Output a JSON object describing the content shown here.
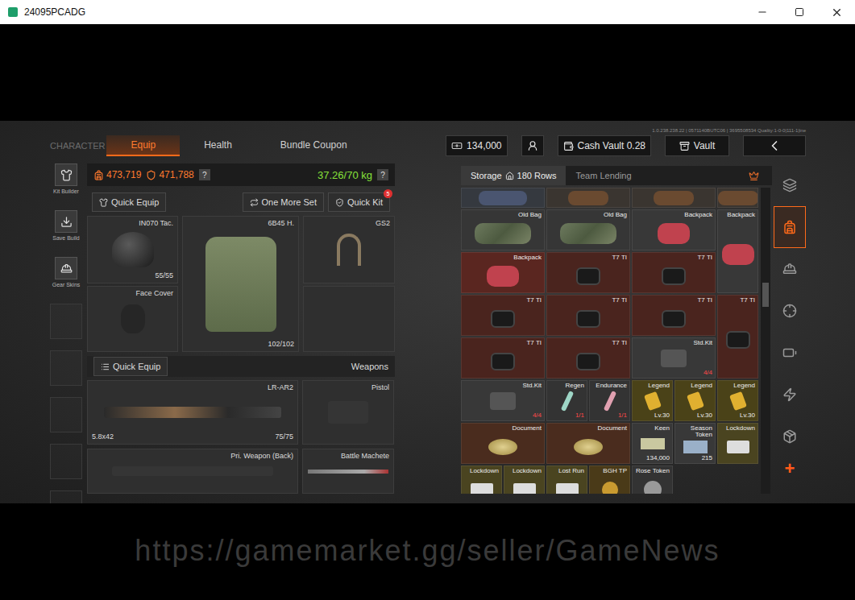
{
  "window": {
    "title": "24095PCADG"
  },
  "version": "1.0.238.238.22 | 0571140BUTC06 | 3695508534  Quality:1-0-0|111-1|ine",
  "nav": {
    "section": "CHARACTER",
    "tabs": [
      {
        "label": "Equip",
        "selected": true
      },
      {
        "label": "Health",
        "selected": false
      },
      {
        "label": "Bundle Coupon",
        "selected": false
      }
    ]
  },
  "wallet": {
    "cash": "134,000",
    "cash_vault": "Cash Vault 0.28",
    "vault": "Vault"
  },
  "tools": [
    {
      "label": "Kit Builder"
    },
    {
      "label": "Save Build"
    },
    {
      "label": "Gear Skins"
    }
  ],
  "stats": {
    "backpack_value": "473,719",
    "gear_value": "471,788",
    "value_help": "?",
    "weight": "37.26/70 kg",
    "weight_help": "?"
  },
  "gear_actions": {
    "quick_equip": "Quick Equip",
    "one_more_set": "One More Set",
    "quick_kit": "Quick Kit",
    "quick_kit_badge": "5"
  },
  "gear": [
    {
      "kind": "helmet",
      "label": "IN070 Tac.",
      "durability": "55/55"
    },
    {
      "kind": "armor",
      "label": "6B45 H.",
      "durability": "102/102"
    },
    {
      "kind": "headset",
      "label": "GS2",
      "durability": ""
    },
    {
      "kind": "face",
      "label": "Face Cover",
      "durability": ""
    },
    {
      "kind": "empty",
      "label": "",
      "durability": ""
    }
  ],
  "weapons_header": {
    "quick_equip": "Quick Equip",
    "title": "Weapons"
  },
  "weapons": [
    {
      "kind": "rifle",
      "label": "LR-AR2",
      "ammo": "5.8x42",
      "durability": "75/75"
    },
    {
      "kind": "pistol",
      "label": "Pistol",
      "ammo": "",
      "durability": ""
    },
    {
      "kind": "back",
      "label": "Pri. Weapon (Back)",
      "ammo": "",
      "durability": ""
    },
    {
      "kind": "melee",
      "label": "Battle Machete",
      "ammo": "",
      "durability": ""
    }
  ],
  "storage": {
    "tabs": [
      {
        "label": "Storage",
        "rows": "180 Rows",
        "selected": true
      },
      {
        "label": "Team Lending",
        "rows": "",
        "selected": false
      }
    ],
    "scroll_level": 0.31,
    "items": [
      {
        "label": "",
        "sub": "",
        "alert": false,
        "kind": "blue-bag",
        "size": "wide",
        "color": "#35393f"
      },
      {
        "label": "",
        "sub": "",
        "alert": false,
        "kind": "brown-bag",
        "size": "wide",
        "color": "#3a3530"
      },
      {
        "label": "",
        "sub": "",
        "alert": false,
        "kind": "brown-bag",
        "size": "wide",
        "color": "#3a3530"
      },
      {
        "label": "",
        "sub": "",
        "alert": false,
        "kind": "brown-bag",
        "size": "small",
        "color": "#3a3530"
      },
      {
        "label": "Old Bag",
        "sub": "",
        "alert": false,
        "kind": "camo-bag",
        "size": "wide",
        "color": "#363636"
      },
      {
        "label": "Old Bag",
        "sub": "",
        "alert": false,
        "kind": "camo-bag",
        "size": "wide",
        "color": "#363636"
      },
      {
        "label": "Backpack",
        "sub": "",
        "alert": false,
        "kind": "red-bag",
        "size": "wide",
        "color": "#383838"
      },
      {
        "label": "Backpack",
        "sub": "",
        "alert": false,
        "kind": "red-bag",
        "size": "tall",
        "color": "#383838"
      },
      {
        "label": "Backpack",
        "sub": "",
        "alert": false,
        "kind": "red-bag",
        "size": "wide",
        "color": "#5a2620"
      },
      {
        "label": "T7 TI",
        "sub": "",
        "alert": false,
        "kind": "nvg",
        "size": "wide",
        "color": "#4a241e"
      },
      {
        "label": "T7 TI",
        "sub": "",
        "alert": false,
        "kind": "nvg",
        "size": "wide",
        "color": "#4a241e"
      },
      {
        "label": "T7 TI",
        "sub": "",
        "alert": false,
        "kind": "nvg",
        "size": "wide",
        "color": "#4a241e"
      },
      {
        "label": "T7 TI",
        "sub": "",
        "alert": false,
        "kind": "nvg",
        "size": "wide",
        "color": "#4a241e"
      },
      {
        "label": "T7 TI",
        "sub": "",
        "alert": false,
        "kind": "nvg",
        "size": "wide",
        "color": "#4a241e"
      },
      {
        "label": "T7 TI",
        "sub": "",
        "alert": false,
        "kind": "nvg",
        "size": "tall",
        "color": "#4a241e"
      },
      {
        "label": "T7 TI",
        "sub": "",
        "alert": false,
        "kind": "nvg",
        "size": "wide",
        "color": "#4a241e"
      },
      {
        "label": "T7 TI",
        "sub": "",
        "alert": false,
        "kind": "nvg",
        "size": "wide",
        "color": "#4a241e"
      },
      {
        "label": "Std.Kit",
        "sub": "4/4",
        "alert": true,
        "kind": "kit",
        "size": "wide",
        "color": "#383838"
      },
      {
        "label": "Std.Kit",
        "sub": "4/4",
        "alert": true,
        "kind": "kit",
        "size": "wide",
        "color": "#383838"
      },
      {
        "label": "Regen",
        "sub": "1/1",
        "alert": true,
        "kind": "syringe-green",
        "size": "small",
        "color": "#333333"
      },
      {
        "label": "Endurance",
        "sub": "1/1",
        "alert": true,
        "kind": "syringe-pink",
        "size": "small",
        "color": "#333333"
      },
      {
        "label": "Legend",
        "sub": "Lv.30",
        "alert": false,
        "kind": "tag",
        "size": "small",
        "color": "#4a4218"
      },
      {
        "label": "Legend",
        "sub": "Lv.30",
        "alert": false,
        "kind": "tag",
        "size": "small",
        "color": "#4a4218"
      },
      {
        "label": "Legend",
        "sub": "Lv.30",
        "alert": false,
        "kind": "tag",
        "size": "small",
        "color": "#4a4218"
      },
      {
        "label": "Document",
        "sub": "",
        "alert": false,
        "kind": "doc",
        "size": "wide",
        "color": "#4a2c1e"
      },
      {
        "label": "Document",
        "sub": "",
        "alert": false,
        "kind": "doc",
        "size": "wide",
        "color": "#4a2c1e"
      },
      {
        "label": "Keen",
        "sub": "134,000",
        "alert": false,
        "kind": "cash",
        "size": "small",
        "color": "#383838"
      },
      {
        "label": "Season Token",
        "sub": "215",
        "alert": false,
        "kind": "ticket",
        "size": "small",
        "color": "#383838"
      },
      {
        "label": "Lockdown",
        "sub": "",
        "alert": false,
        "kind": "card",
        "size": "small",
        "color": "#4a4420"
      },
      {
        "label": "Lockdown",
        "sub": "",
        "alert": false,
        "kind": "card",
        "size": "small",
        "color": "#4a4420"
      },
      {
        "label": "Lockdown",
        "sub": "",
        "alert": false,
        "kind": "card",
        "size": "small",
        "color": "#4a4420"
      },
      {
        "label": "Lost Run",
        "sub": "",
        "alert": false,
        "kind": "card",
        "size": "small",
        "color": "#4a4420"
      },
      {
        "label": "BGH TP",
        "sub": "",
        "alert": false,
        "kind": "coin",
        "size": "small",
        "color": "#4a3a18"
      },
      {
        "label": "Rose Token",
        "sub": "",
        "alert": false,
        "kind": "token",
        "size": "small",
        "color": "#333333"
      }
    ]
  },
  "sidebar": [
    {
      "selected": false
    },
    {
      "selected": true
    },
    {
      "selected": false
    },
    {
      "selected": false
    },
    {
      "selected": false
    },
    {
      "selected": false
    },
    {
      "selected": false
    }
  ],
  "sidebar_add": "+",
  "watermark": "https://gamemarket.gg/seller/GameNews"
}
